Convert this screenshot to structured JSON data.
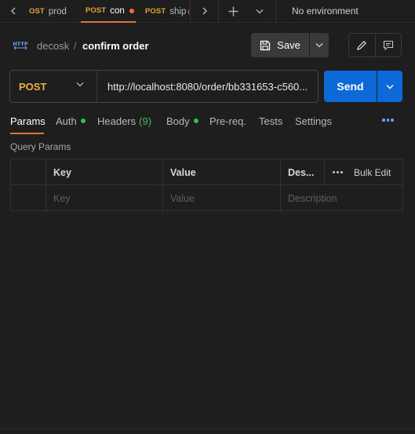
{
  "tabs": [
    {
      "method": "POST",
      "method_visible": "OST",
      "name": "prod"
    },
    {
      "method": "POST",
      "name": "con",
      "active": true
    },
    {
      "method": "POST",
      "name": "ship"
    }
  ],
  "environment": "No environment",
  "breadcrumb": {
    "icon": "HTTP",
    "collection": "decosk",
    "separator": "/",
    "request": "confirm order"
  },
  "toolbar": {
    "save_label": "Save"
  },
  "request": {
    "method": "POST",
    "url": "http://localhost:8080/order/bb331653-c560..."
  },
  "send_label": "Send",
  "request_tabs": {
    "params": "Params",
    "auth": "Auth",
    "headers": "Headers",
    "headers_count": "(9)",
    "body": "Body",
    "prereq": "Pre-req.",
    "tests": "Tests",
    "settings": "Settings"
  },
  "query_params": {
    "title": "Query Params",
    "columns": {
      "key": "Key",
      "value": "Value",
      "description": "Des..."
    },
    "bulk_edit": "Bulk Edit",
    "placeholders": {
      "key": "Key",
      "value": "Value",
      "description": "Description"
    }
  },
  "colors": {
    "accent": "#e0773a",
    "send": "#0c6ad8",
    "method": "#e8b23e",
    "status_dot": "#2fbf53"
  }
}
